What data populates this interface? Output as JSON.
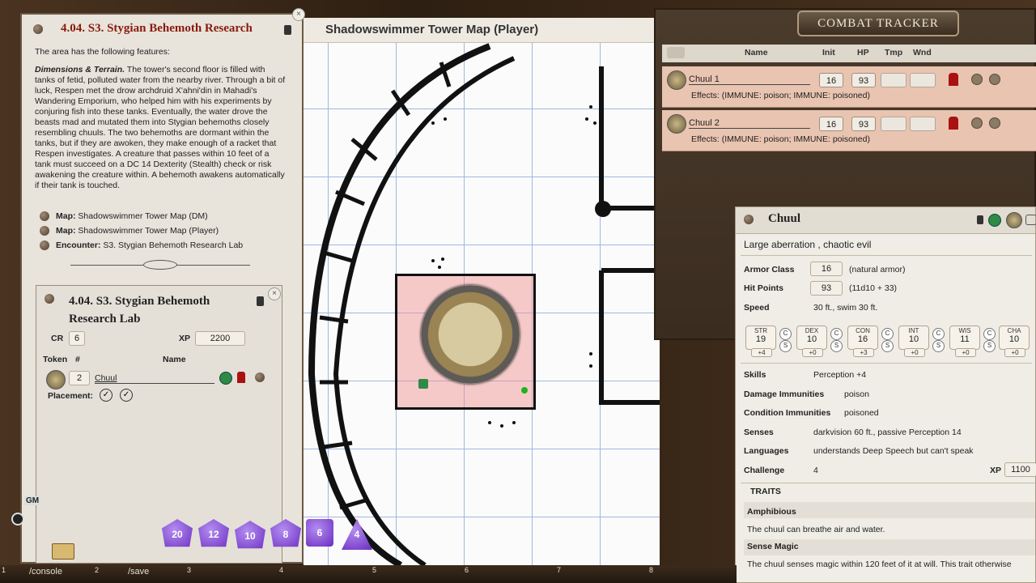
{
  "colors": {
    "accent_title": "#8a1a0a",
    "ct_row_bg": "#e9c4b0",
    "dice_purple": "#8a4be0"
  },
  "story": {
    "title": "4.04. S3. Stygian Behemoth Research",
    "intro": "The area has the following features:",
    "body_lead": "Dimensions & Terrain.",
    "body_text": "The tower's second floor is filled with tanks of fetid, polluted water from the nearby river. Through a bit of luck, Respen met the drow archdruid X'ahni'din in Mahadi's Wandering Emporium, who helped him with his experiments by conjuring fish into these tanks. Eventually, the water drove the beasts mad and mutated them into Stygian behemoths closely resembling chuuls. The two behemoths are dormant within the tanks, but if they are awoken, they make enough of a racket that Respen investigates. A creature that passes within 10 feet of a tank must succeed on a DC 14 Dexterity (Stealth) check or risk awakening the creature within. A behemoth awakens automatically if their tank is touched.",
    "links": [
      {
        "prefix": "Map:",
        "text": "Shadowswimmer Tower Map (DM)"
      },
      {
        "prefix": "Map:",
        "text": "Shadowswimmer Tower Map (Player)"
      },
      {
        "prefix": "Encounter:",
        "text": "S3. Stygian Behemoth Research Lab"
      }
    ]
  },
  "encounter": {
    "title": "4.04. S3. Stygian Behemoth Research Lab",
    "cr_label": "CR",
    "cr_value": "6",
    "xp_label": "XP",
    "xp_value": "2200",
    "token_header": "Token",
    "hash_header": "#",
    "name_header": "Name",
    "count": "2",
    "creature": "Chuul",
    "placement_label": "Placement:"
  },
  "map": {
    "title": "Shadowswimmer Tower Map (Player)"
  },
  "combat_tracker": {
    "title": "COMBAT TRACKER",
    "columns": {
      "name": "Name",
      "init": "Init",
      "hp": "HP",
      "tmp": "Tmp",
      "wnd": "Wnd"
    },
    "rows": [
      {
        "name": "Chuul 1",
        "init": "16",
        "hp": "93",
        "effects": "Effects: (IMMUNE: poison; IMMUNE: poisoned)"
      },
      {
        "name": "Chuul 2",
        "init": "16",
        "hp": "93",
        "effects": "Effects: (IMMUNE: poison; IMMUNE: poisoned)"
      }
    ]
  },
  "npc": {
    "name": "Chuul",
    "type_line": "Large aberration , chaotic evil",
    "ac_label": "Armor Class",
    "ac_value": "16",
    "ac_note": "(natural armor)",
    "hp_label": "Hit Points",
    "hp_value": "93",
    "hp_note": "(11d10 + 33)",
    "speed_label": "Speed",
    "speed_value": "30 ft., swim 30 ft.",
    "stats": [
      {
        "name": "STR",
        "value": "19",
        "mod": "+4"
      },
      {
        "name": "DEX",
        "value": "10",
        "mod": "+0"
      },
      {
        "name": "CON",
        "value": "16",
        "mod": "+3"
      },
      {
        "name": "INT",
        "value": "10",
        "mod": "+0"
      },
      {
        "name": "WIS",
        "value": "11",
        "mod": "+0"
      },
      {
        "name": "CHA",
        "value": "10",
        "mod": "+0"
      }
    ],
    "skills_label": "Skills",
    "skills_value": "Perception +4",
    "dmg_imm_label": "Damage Immunities",
    "dmg_imm_value": "poison",
    "cond_imm_label": "Condition Immunities",
    "cond_imm_value": "poisoned",
    "senses_label": "Senses",
    "senses_value": "darkvision 60 ft., passive Perception 14",
    "languages_label": "Languages",
    "languages_value": "understands Deep Speech but can't speak",
    "challenge_label": "Challenge",
    "challenge_value": "4",
    "xp_label": "XP",
    "xp_value": "1100",
    "traits_header": "TRAITS",
    "trait1_name": "Amphibious",
    "trait1_text": "The chuul can breathe air and water.",
    "trait2_name": "Sense Magic",
    "trait2_text": "The chuul senses magic within 120 feet of it at will. This trait otherwise"
  },
  "dice": [
    "d20",
    "d12",
    "d10",
    "d8",
    "d6",
    "d4"
  ],
  "hotbar": {
    "gm_label": "GM",
    "keys": [
      {
        "num": "1",
        "label": "/console"
      },
      {
        "num": "2",
        "label": "/save"
      },
      {
        "num": "3",
        "label": ""
      },
      {
        "num": "4",
        "label": ""
      },
      {
        "num": "5",
        "label": ""
      },
      {
        "num": "6",
        "label": ""
      },
      {
        "num": "7",
        "label": ""
      },
      {
        "num": "8",
        "label": ""
      }
    ]
  }
}
